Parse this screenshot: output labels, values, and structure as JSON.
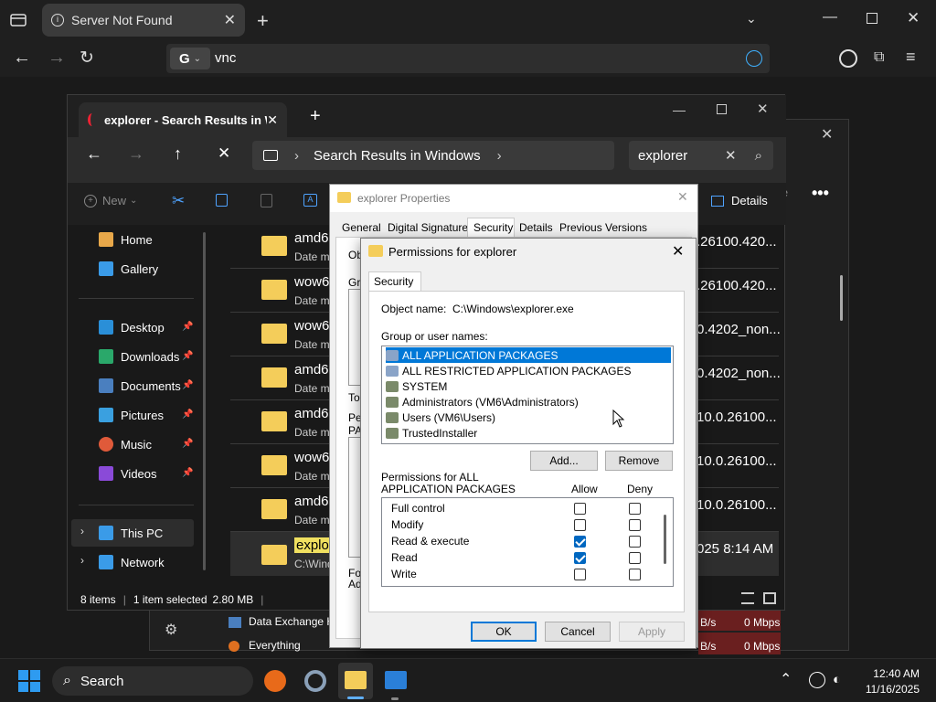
{
  "browser": {
    "tab_title": "Server Not Found",
    "address": "vnc"
  },
  "explorer": {
    "tab_title": "explorer - Search Results in Wi",
    "breadcrumb": "Search Results in Windows",
    "search_value": "explorer",
    "cmd_new": "New",
    "details_label": "Details",
    "sidebar": [
      {
        "label": "Home",
        "pinned": false
      },
      {
        "label": "Gallery",
        "pinned": false
      },
      {
        "label": "Desktop",
        "pinned": true
      },
      {
        "label": "Downloads",
        "pinned": true
      },
      {
        "label": "Documents",
        "pinned": true
      },
      {
        "label": "Pictures",
        "pinned": true
      },
      {
        "label": "Music",
        "pinned": true
      },
      {
        "label": "Videos",
        "pinned": true
      },
      {
        "label": "This PC",
        "pinned": false
      },
      {
        "label": "Network",
        "pinned": false
      }
    ],
    "files": [
      {
        "name": "amd6",
        "sub": "Date m",
        "right": ".26100.420..."
      },
      {
        "name": "wow6",
        "sub": "Date m",
        "right": ".26100.420..."
      },
      {
        "name": "wow6",
        "sub": "Date m",
        "right": "0.4202_non..."
      },
      {
        "name": "amd6",
        "sub": "Date m",
        "right": "0.4202_non..."
      },
      {
        "name": "amd6",
        "sub": "Date m",
        "right": "10.0.26100..."
      },
      {
        "name": "wow6",
        "sub": "Date m",
        "right": "10.0.26100..."
      },
      {
        "name": "amd6",
        "sub": "Date m",
        "right": "10.0.26100..."
      },
      {
        "name": "explor",
        "sub": "C:\\Wind",
        "right": "025 8:14 AM"
      }
    ],
    "status_items": "8 items",
    "status_selected": "1 item selected",
    "status_size": "2.80 MB"
  },
  "properties": {
    "title": "explorer Properties",
    "tabs": [
      "General",
      "Digital Signatures",
      "Security",
      "Details",
      "Previous Versions"
    ],
    "partial_labels": [
      "Ob",
      "Gr",
      "To",
      "Pe",
      "PA",
      "Fo",
      "Ad"
    ]
  },
  "permissions": {
    "title": "Permissions for explorer",
    "tab": "Security",
    "object_label": "Object name:",
    "object_value": "C:\\Windows\\explorer.exe",
    "group_label": "Group or user names:",
    "users": [
      {
        "name": "ALL APPLICATION PACKAGES",
        "selected": true
      },
      {
        "name": "ALL RESTRICTED APPLICATION PACKAGES",
        "selected": false
      },
      {
        "name": "SYSTEM",
        "selected": false
      },
      {
        "name": "Administrators (VM6\\Administrators)",
        "selected": false
      },
      {
        "name": "Users (VM6\\Users)",
        "selected": false
      },
      {
        "name": "TrustedInstaller",
        "selected": false
      }
    ],
    "add_label": "Add...",
    "remove_label": "Remove",
    "perm_for_line1": "Permissions for ALL",
    "perm_for_line2": "APPLICATION PACKAGES",
    "allow_label": "Allow",
    "deny_label": "Deny",
    "perms": [
      {
        "name": "Full control",
        "allow": false,
        "deny": false
      },
      {
        "name": "Modify",
        "allow": false,
        "deny": false
      },
      {
        "name": "Read & execute",
        "allow": true,
        "deny": false
      },
      {
        "name": "Read",
        "allow": true,
        "deny": false
      },
      {
        "name": "Write",
        "allow": false,
        "deny": false
      }
    ],
    "ok_label": "OK",
    "cancel_label": "Cancel",
    "apply_label": "Apply"
  },
  "taskmgr": {
    "rows": [
      {
        "name": "Data Exchange H",
        "value": "0 Mbps",
        "unit": "B/s"
      },
      {
        "name": "Everything",
        "value": "0 Mbps",
        "unit": "B/s"
      }
    ]
  },
  "taskbar": {
    "search_placeholder": "Search",
    "time": "12:40 AM",
    "date": "11/16/2025"
  }
}
